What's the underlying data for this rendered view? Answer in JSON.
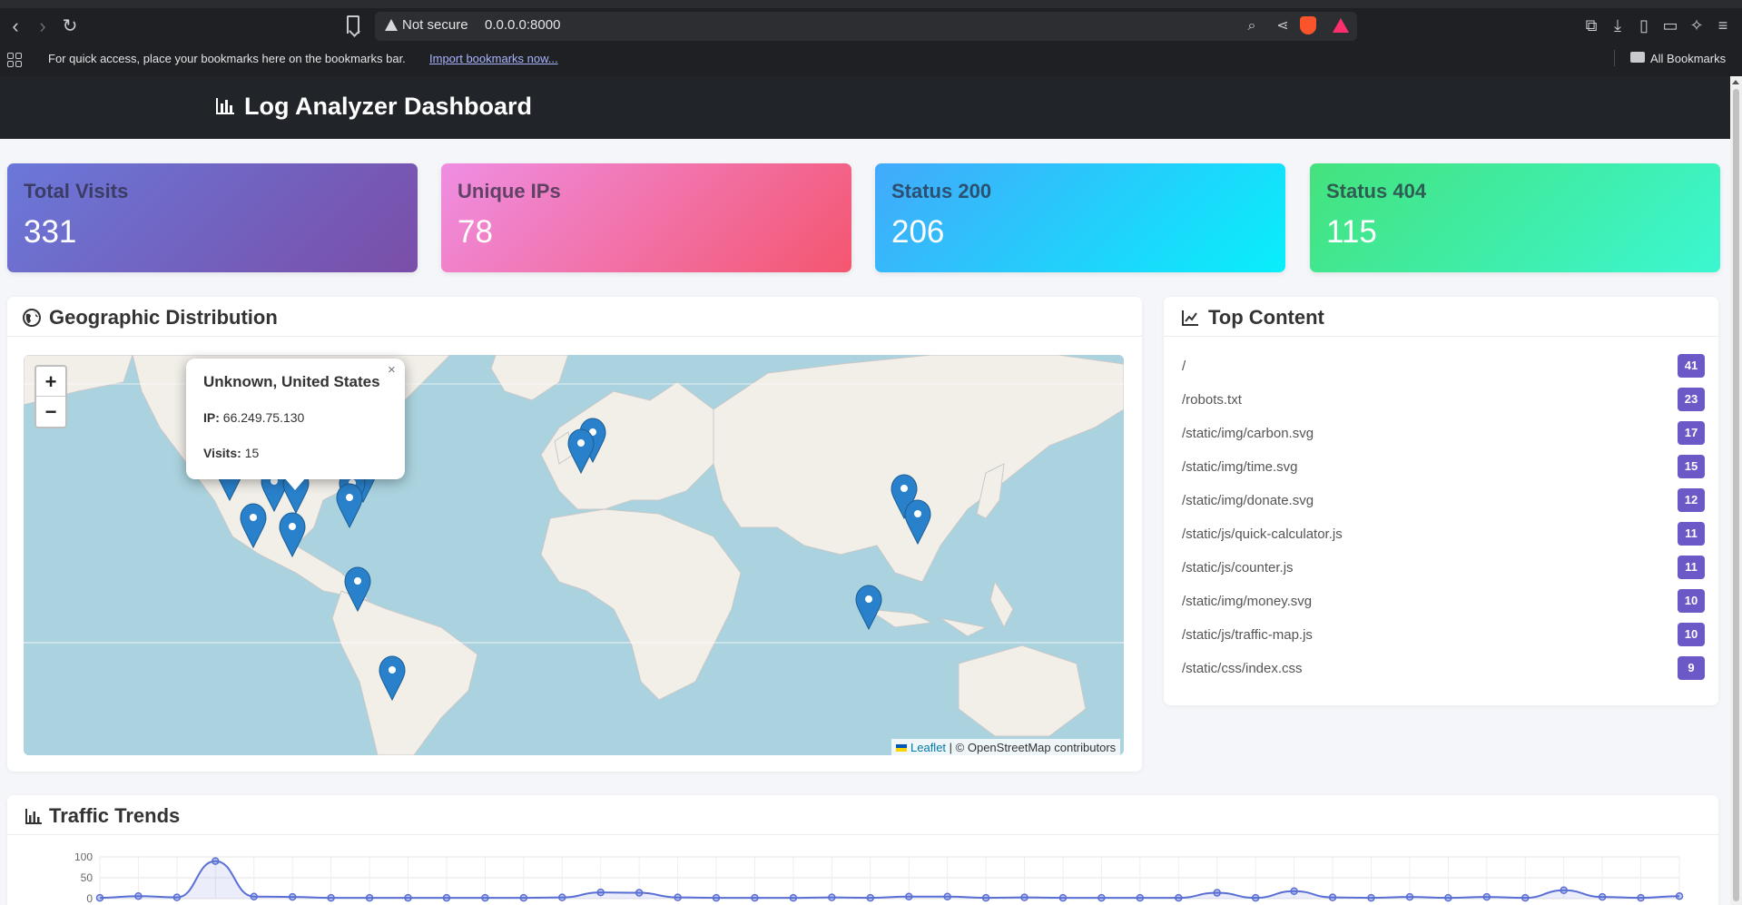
{
  "browser": {
    "not_secure": "Not secure",
    "url": "0.0.0.0:8000",
    "bookmarks_text": "For quick access, place your bookmarks here on the bookmarks bar.",
    "import_link": "Import bookmarks now...",
    "all_bookmarks": "All Bookmarks"
  },
  "app": {
    "title": "Log Analyzer Dashboard"
  },
  "stats": [
    {
      "label": "Total Visits",
      "value": "331"
    },
    {
      "label": "Unique IPs",
      "value": "78"
    },
    {
      "label": "Status 200",
      "value": "206"
    },
    {
      "label": "Status 404",
      "value": "115"
    }
  ],
  "geo": {
    "title": "Geographic Distribution",
    "zoom_in": "+",
    "zoom_out": "−",
    "popup": {
      "close": "×",
      "title": "Unknown, United States",
      "ip_label": "IP:",
      "ip": "66.249.75.130",
      "visits_label": "Visits:",
      "visits": "15"
    },
    "attribution_link": "Leaflet",
    "attribution_text": "| © OpenStreetMap contributors"
  },
  "top_content": {
    "title": "Top Content",
    "items": [
      {
        "path": "/",
        "count": "41"
      },
      {
        "path": "/robots.txt",
        "count": "23"
      },
      {
        "path": "/static/img/carbon.svg",
        "count": "17"
      },
      {
        "path": "/static/img/time.svg",
        "count": "15"
      },
      {
        "path": "/static/img/donate.svg",
        "count": "12"
      },
      {
        "path": "/static/js/quick-calculator.js",
        "count": "11"
      },
      {
        "path": "/static/js/counter.js",
        "count": "11"
      },
      {
        "path": "/static/img/money.svg",
        "count": "10"
      },
      {
        "path": "/static/js/traffic-map.js",
        "count": "10"
      },
      {
        "path": "/static/css/index.css",
        "count": "9"
      }
    ]
  },
  "traffic": {
    "title": "Traffic Trends",
    "chart_data": {
      "type": "line",
      "yticks": [
        "100",
        "50",
        "0"
      ],
      "ylim": [
        0,
        100
      ],
      "values": [
        2,
        6,
        3,
        90,
        5,
        4,
        2,
        2,
        2,
        2,
        2,
        2,
        3,
        15,
        14,
        3,
        2,
        2,
        2,
        3,
        2,
        5,
        5,
        2,
        3,
        2,
        2,
        2,
        2,
        14,
        2,
        18,
        3,
        2,
        4,
        2,
        4,
        2,
        20,
        4,
        2,
        6
      ],
      "line_color": "#5a6fd6"
    }
  },
  "colors": {
    "header_bg": "#212529",
    "badge": "#6c58c6",
    "marker": "#2a81cb"
  }
}
